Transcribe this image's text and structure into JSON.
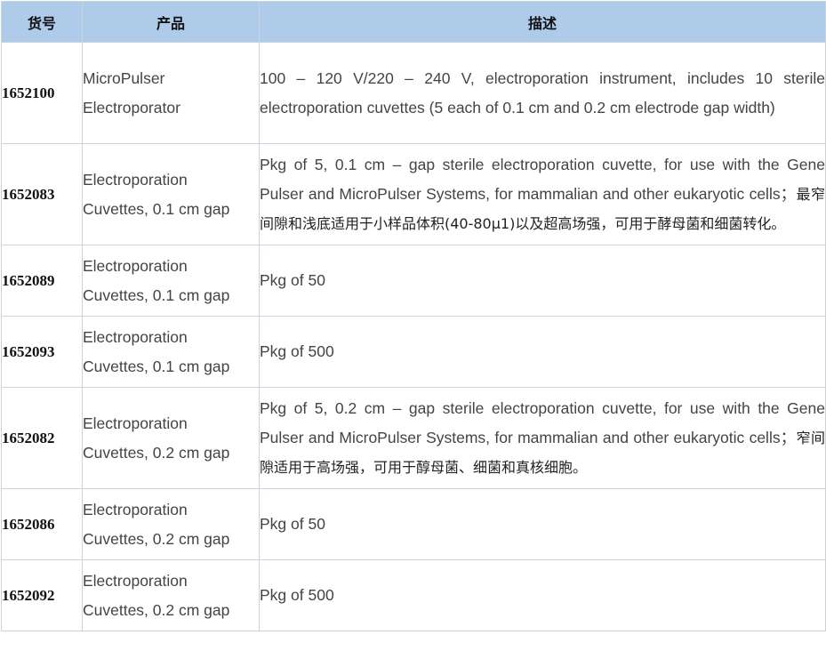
{
  "table": {
    "headers": [
      "货号",
      "产品",
      "描述"
    ],
    "rows": [
      {
        "code": "1652100",
        "product_line1": "MicroPulser",
        "product_line2": "Electroporator",
        "desc": "100 – 120 V/220 – 240 V, electroporation instrument, includes 10 sterile electroporation cuvettes (5 each of 0.1 cm and 0.2 cm electrode gap width)",
        "desc_cn": ""
      },
      {
        "code": "1652083",
        "product_line1": "Electroporation",
        "product_line2": "Cuvettes, 0.1 cm gap",
        "desc": "Pkg of 5, 0.1 cm – gap sterile electroporation cuvette, for use with the Gene Pulser and MicroPulser Systems, for mammalian and other eukaryotic cells；",
        "desc_cn": "最窄间隙和浅底适用于小样品体积(40-80μ1)以及超高场强，可用于酵母菌和细菌转化。"
      },
      {
        "code": "1652089",
        "product_line1": "Electroporation",
        "product_line2": "Cuvettes, 0.1 cm gap",
        "desc": "Pkg of 50",
        "desc_cn": ""
      },
      {
        "code": "1652093",
        "product_line1": "Electroporation",
        "product_line2": "Cuvettes, 0.1 cm gap",
        "desc": "Pkg of 500",
        "desc_cn": ""
      },
      {
        "code": "1652082",
        "product_line1": "Electroporation",
        "product_line2": "Cuvettes, 0.2 cm gap",
        "desc": "Pkg of 5, 0.2 cm – gap sterile electroporation cuvette, for use with the Gene Pulser and MicroPulser Systems, for mammalian and other eukaryotic cells；",
        "desc_cn": "窄间隙适用于高场强，可用于醇母菌、细菌和真核细胞。"
      },
      {
        "code": "1652086",
        "product_line1": "Electroporation",
        "product_line2": "Cuvettes, 0.2 cm gap",
        "desc": "Pkg of 50",
        "desc_cn": ""
      },
      {
        "code": "1652092",
        "product_line1": "Electroporation",
        "product_line2": "Cuvettes, 0.2 cm gap",
        "desc": "Pkg of 500",
        "desc_cn": ""
      }
    ]
  },
  "colors": {
    "header_bg": "#aecbea",
    "border": "#c9d3de",
    "text": "#444444"
  }
}
